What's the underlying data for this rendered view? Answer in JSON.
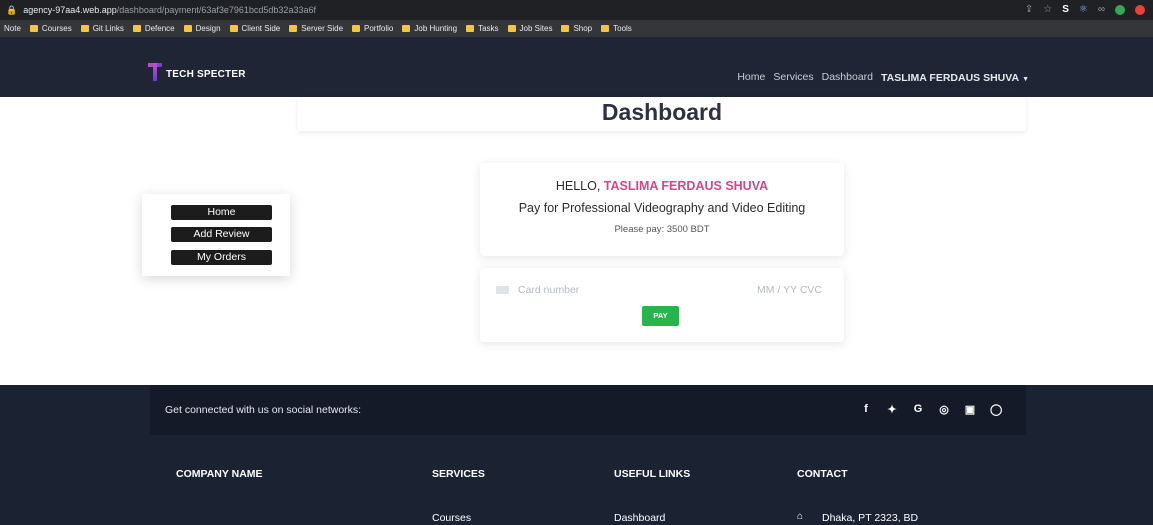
{
  "browser": {
    "url_host": "agency-97aa4.web.app",
    "url_path": "/dashboard/payment/63af3e7961bcd5db32a33a6f",
    "icons": [
      "share-icon",
      "star-icon",
      "extension-s-icon",
      "extension-react-icon",
      "extension-glasses-icon",
      "extension-g-icon",
      "extension-red-icon"
    ],
    "bookmarks": [
      "Note",
      "Courses",
      "Git Links",
      "Defence",
      "Design",
      "Client Side",
      "Server Side",
      "Portfolio",
      "Job Hunting",
      "Tasks",
      "Job Sites",
      "Shop",
      "Tools"
    ]
  },
  "navbar": {
    "logo_text": "TECH SPECTER",
    "links": [
      "Home",
      "Services",
      "Dashboard"
    ],
    "user_name": "TASLIMA FERDAUS SHUVA"
  },
  "page": {
    "title": "Dashboard"
  },
  "sidebar": {
    "buttons": [
      "Home",
      "Add Review",
      "My Orders"
    ]
  },
  "greeting": {
    "hello": "HELLO,",
    "name": "TASLIMA FERDAUS SHUVA",
    "service": "Pay for Professional Videography and Video Editing",
    "price_text": "Please pay: 3500 BDT"
  },
  "payment": {
    "card_placeholder": "Card number",
    "expiry_placeholder": "MM / YY  CVC",
    "pay_label": "PAY"
  },
  "footer": {
    "social_text": "Get connected with us on social networks:",
    "social_icons": [
      "f",
      "🐦",
      "G",
      "◎",
      "▣",
      "◯"
    ],
    "columns": [
      {
        "heading": "COMPANY NAME",
        "first_link": ""
      },
      {
        "heading": "SERVICES",
        "first_link": "Courses"
      },
      {
        "heading": "USEFUL LINKS",
        "first_link": "Dashboard"
      },
      {
        "heading": "CONTACT",
        "first_link": "Dhaka, PT 2323, BD"
      }
    ]
  },
  "colors": {
    "navbar_bg": "#1f2535",
    "accent_name": "#d2488a",
    "pay_button": "#27b44a",
    "footer_bg": "#1b2232"
  }
}
